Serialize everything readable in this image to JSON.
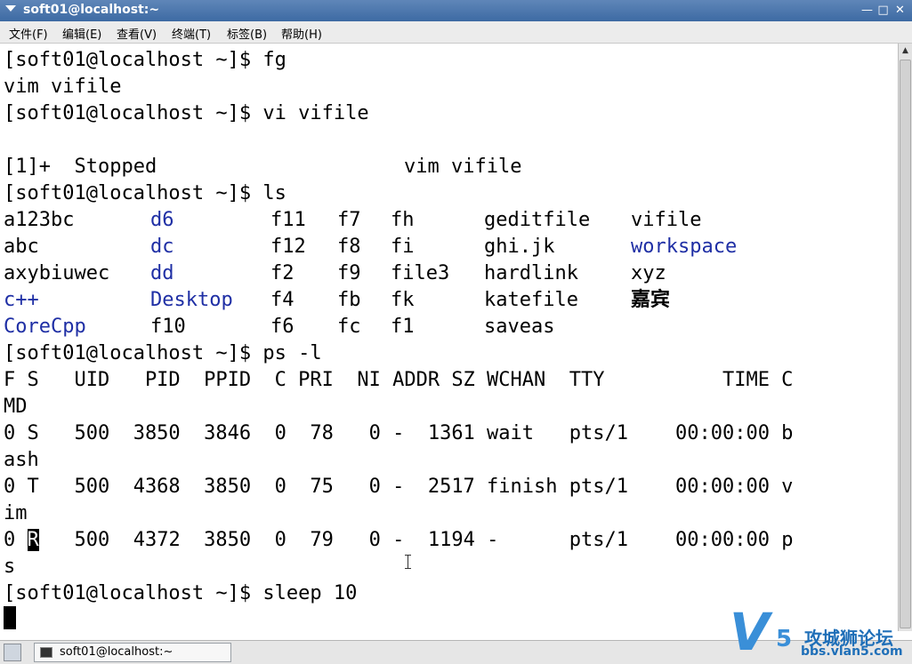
{
  "window": {
    "title": "soft01@localhost:~"
  },
  "menu": [
    "文件(F)",
    "编辑(E)",
    "查看(V)",
    "终端(T)",
    "标签(B)",
    "帮助(H)"
  ],
  "terminal": {
    "l0": "[soft01@localhost ~]$ fg",
    "l1": "vim vifile",
    "l2": "[soft01@localhost ~]$ vi vifile",
    "l4a": "[1]+  Stopped",
    "l4b": "vim vifile",
    "l5": "[soft01@localhost ~]$ ls",
    "ls": [
      [
        "a123bc",
        "d6",
        "f11",
        "f7",
        "fh",
        "geditfile",
        "vifile"
      ],
      [
        "abc",
        "dc",
        "f12",
        "f8",
        "fi",
        "ghi.jk",
        "workspace"
      ],
      [
        "axybiuwec",
        "dd",
        "f2",
        "f9",
        "file3",
        "hardlink",
        "xyz"
      ],
      [
        "c++",
        "Desktop",
        "f4",
        "fb",
        "fk",
        "katefile",
        "嘉宾"
      ],
      [
        "CoreCpp",
        "f10",
        "f6",
        "fc",
        "f1",
        "saveas",
        ""
      ]
    ],
    "l11": "[soft01@localhost ~]$ ps -l",
    "ps_header": "F S   UID   PID  PPID  C PRI  NI ADDR SZ WCHAN  TTY          TIME C",
    "ps_header_wrap": "MD",
    "ps_r1": "0 S   500  3850  3846  0  78   0 -  1361 wait   pts/1    00:00:00 b",
    "ps_r1_wrap": "ash",
    "ps_r2": "0 T   500  4368  3850  0  75   0 -  2517 finish pts/1    00:00:00 v",
    "ps_r2_wrap": "im",
    "ps_r3_a": "0 ",
    "ps_r3_sel": "R",
    "ps_r3_b": "   500  4372  3850  0  79   0 -  1194 -      pts/1    00:00:00 p",
    "ps_r3_wrap": "s",
    "l20": "[soft01@localhost ~]$ sleep 10"
  },
  "taskbar": {
    "task_label": "soft01@localhost:~"
  },
  "logo": {
    "text": "攻城狮论坛",
    "url": "bbs.vlan5.com",
    "v": "V",
    "five": "5"
  },
  "colors": {
    "titlebar": "#4a76ad",
    "dir_blue": "#1f2fa5",
    "logo_blue": "#3a8fd8"
  }
}
